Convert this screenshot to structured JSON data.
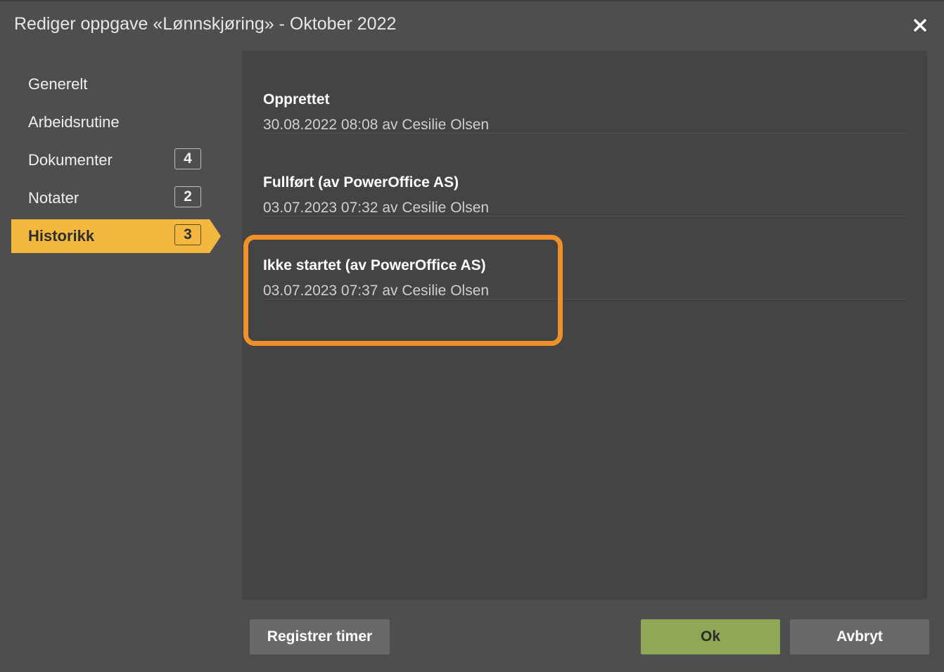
{
  "dialog": {
    "title": "Rediger oppgave «Lønnskjøring» - Oktober 2022",
    "close_icon": "close-icon"
  },
  "sidebar": {
    "items": [
      {
        "label": "Generelt",
        "badge": null
      },
      {
        "label": "Arbeidsrutine",
        "badge": null
      },
      {
        "label": "Dokumenter",
        "badge": "4"
      },
      {
        "label": "Notater",
        "badge": "2"
      },
      {
        "label": "Historikk",
        "badge": "3",
        "active": true
      }
    ]
  },
  "history": {
    "entries": [
      {
        "title": "Opprettet",
        "meta": "30.08.2022 08:08 av Cesilie Olsen"
      },
      {
        "title": "Fullført (av PowerOffice AS)",
        "meta": "03.07.2023 07:32 av Cesilie Olsen"
      },
      {
        "title": "Ikke startet (av PowerOffice AS)",
        "meta": "03.07.2023 07:37 av Cesilie Olsen",
        "highlighted": true
      }
    ]
  },
  "footer": {
    "register_label": "Registrer timer",
    "ok_label": "Ok",
    "cancel_label": "Avbryt"
  },
  "colors": {
    "active_tab": "#f4b740",
    "highlight_border": "#f0902a",
    "ok_button": "#8ea855",
    "secondary_button": "#696969"
  }
}
